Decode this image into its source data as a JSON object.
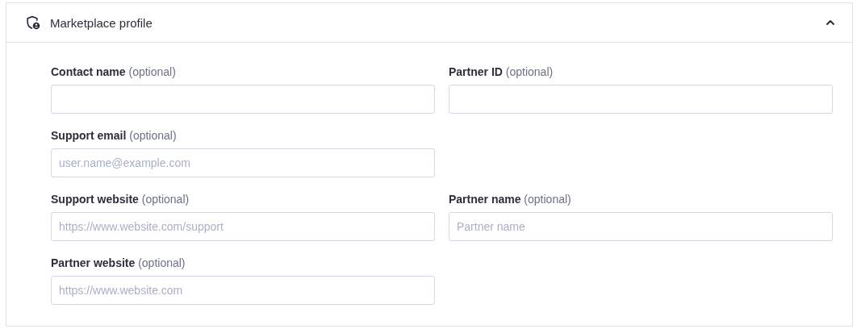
{
  "section": {
    "title": "Marketplace profile",
    "expanded": true
  },
  "rows": [
    [
      {
        "label": "**Contact name** (optional)"
      },
      {
        "label": "**Partner ID** (optional)"
      }
    ],
    [
      {
        "label": "**Support email** (optional)",
        "placeholder": "user.name@example.com"
      }
    ],
    [
      {
        "label": "**Support website** (optional)",
        "placeholder": "https://www.website.com/support"
      },
      {
        "label": "**Partner name** (optional)",
        "placeholder": "Partner name"
      }
    ],
    [
      {
        "label": "**Partner website** (optional)",
        "placeholder": "https://www.website.com"
      }
    ]
  ]
}
